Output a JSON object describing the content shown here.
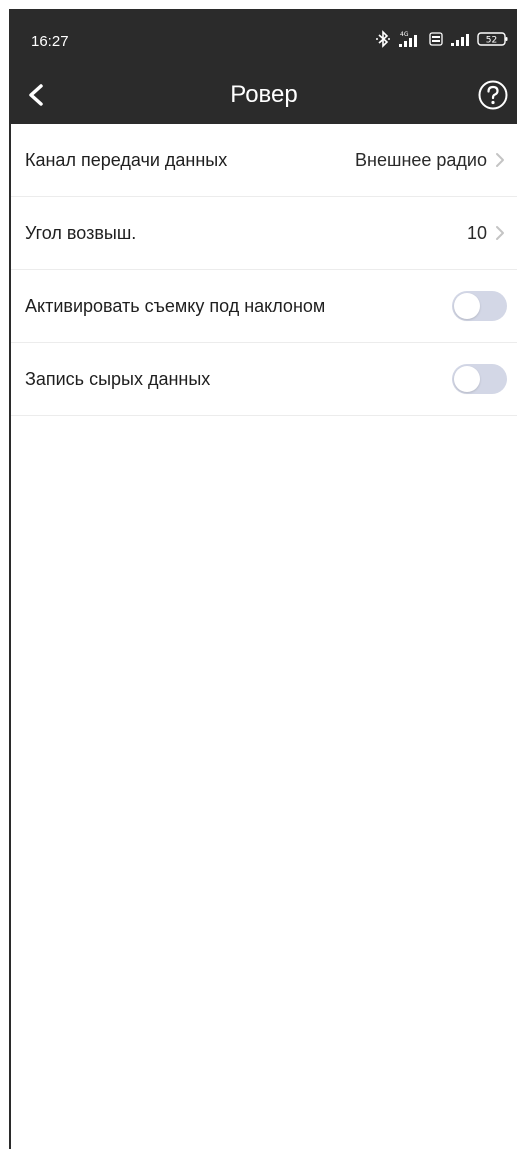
{
  "status_bar": {
    "time": "16:27",
    "battery": "52",
    "network": "4G"
  },
  "header": {
    "title": "Ровер",
    "back_icon": "chevron-left-icon",
    "help_icon": "question-circle-icon"
  },
  "settings": [
    {
      "label": "Канал передачи данных",
      "value": "Внешнее радио",
      "type": "link"
    },
    {
      "label": "Угол возвыш.",
      "value": "10",
      "type": "link"
    },
    {
      "label": "Активировать съемку под наклоном",
      "type": "toggle",
      "checked": false
    },
    {
      "label": "Запись сырых данных",
      "type": "toggle",
      "checked": false
    }
  ],
  "colors": {
    "header_bg": "#2b2b2b",
    "toggle_off": "#d3d7e6",
    "chevron": "#c4c4c4"
  }
}
